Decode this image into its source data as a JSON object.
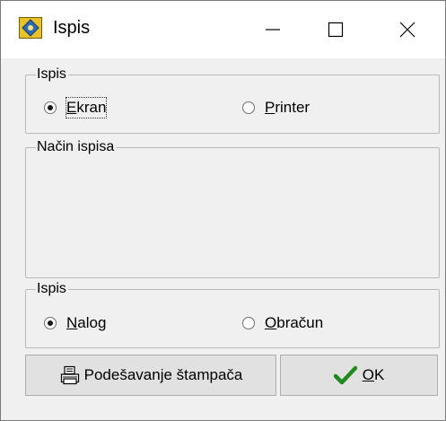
{
  "window": {
    "title": "Ispis"
  },
  "group_output": {
    "label": "Ispis",
    "options": [
      {
        "first": "E",
        "rest": "kran",
        "checked": true
      },
      {
        "first": "P",
        "rest": "rinter",
        "checked": false
      }
    ]
  },
  "group_mode": {
    "label": "Način ispisa"
  },
  "group_type": {
    "label": "Ispis",
    "options": [
      {
        "first": "N",
        "rest": "alog",
        "checked": true
      },
      {
        "first": "O",
        "rest": "bračun",
        "checked": false
      }
    ]
  },
  "buttons": {
    "printer_setup": "Podešavanje štampača",
    "ok_first": "O",
    "ok_rest": "K"
  },
  "icons": {
    "app": "app-emblem-icon",
    "printer": "printer-icon",
    "ok": "checkmark-icon"
  },
  "colors": {
    "ok_check": "#1e8a1e"
  }
}
